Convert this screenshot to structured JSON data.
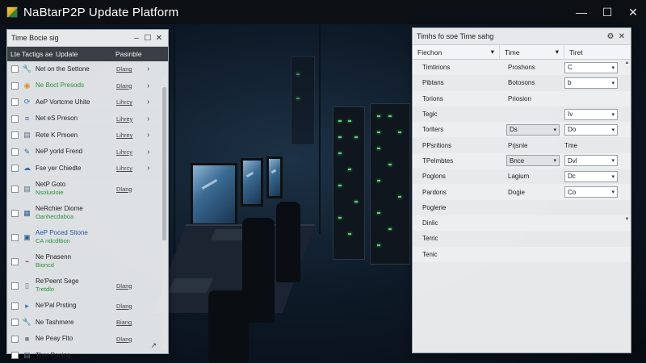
{
  "app": {
    "title": "NaBtarP2P Update Platform",
    "window_controls": {
      "minimize": "—",
      "maximize": "☐",
      "close": "✕"
    }
  },
  "left_panel": {
    "title": "Time Bocie sig",
    "controls": {
      "minimize": "–",
      "maximize": "☐",
      "close": "✕"
    },
    "columns": [
      "Lte Tactigs ae",
      "Update",
      "Pasinble"
    ],
    "rows": [
      {
        "label": "Net on the Settone",
        "status": "Dlang",
        "icon": "wrench-icon",
        "has_arrow": true,
        "style": ""
      },
      {
        "label": "Ne Boct Presods",
        "status": "Dlang",
        "icon": "chrome-icon",
        "has_arrow": true,
        "style": "green"
      },
      {
        "label": "AeP Vortcme Uhite",
        "status": "Lihrcy",
        "icon": "refresh-icon",
        "has_arrow": true,
        "style": ""
      },
      {
        "label": "Net eS Preson",
        "status": "Lihrey",
        "icon": "list-icon",
        "has_arrow": true,
        "style": ""
      },
      {
        "label": "Rete K Pmoen",
        "status": "Lihrey",
        "icon": "document-icon",
        "has_arrow": true,
        "style": ""
      },
      {
        "label": "NeP yorld Frend",
        "status": "Lihrcy",
        "icon": "tool-icon",
        "has_arrow": true,
        "style": ""
      },
      {
        "label": "Fse yer Chiedte",
        "status": "Lihrcy",
        "icon": "cloud-icon",
        "has_arrow": true,
        "style": ""
      },
      {
        "label": "NetP Goto",
        "sub": "Nsolusloie",
        "status": "Dlang",
        "icon": "document-icon",
        "has_arrow": false,
        "style": ""
      },
      {
        "label": "NeRchier Diome",
        "sub": "Oanhecdaboa",
        "status": "",
        "icon": "grid-icon",
        "has_arrow": false,
        "style": ""
      },
      {
        "label": "AeP Poced Sitone",
        "sub": "CA ndcdtbon",
        "status": "",
        "icon": "image-icon",
        "has_arrow": false,
        "style": "blue"
      },
      {
        "label": "Ne Pnasenn",
        "sub": "Bioncd",
        "status": "",
        "icon": "chart-icon",
        "has_arrow": false,
        "style": ""
      },
      {
        "label": "Re'Peent Sege",
        "sub": "Tretdlo",
        "status": "Dlang",
        "icon": "file-icon",
        "has_arrow": false,
        "style": ""
      },
      {
        "label": "Ne'Pal Prsting",
        "status": "Dlang",
        "icon": "play-icon",
        "has_arrow": false,
        "style": ""
      },
      {
        "label": "Ne Tashmere",
        "status": "Biang",
        "icon": "wrench-icon",
        "has_arrow": false,
        "style": ""
      },
      {
        "label": "Ne Peay Flto",
        "status": "Dlang",
        "icon": "box-icon",
        "has_arrow": false,
        "style": ""
      },
      {
        "label": "Ther Pooing",
        "status": "",
        "icon": "document-icon",
        "has_arrow": false,
        "style": ""
      }
    ],
    "footer": "↗"
  },
  "right_panel": {
    "title": "Timhs fo soe Time sahg",
    "controls": {
      "settings": "⚙",
      "close": "✕"
    },
    "columns": [
      "Fiechon",
      "Time",
      "Tiret"
    ],
    "rows": [
      {
        "c1": "Timtirions",
        "c2": "Proshons",
        "c3": "C"
      },
      {
        "c1": "Pibtans",
        "c2": "Botosons",
        "c3": "b"
      },
      {
        "c1": "Torions",
        "c2": "Priosion",
        "c3": ""
      },
      {
        "c1": "Tegic",
        "c2": "",
        "c3": "Iv"
      },
      {
        "c1": "Torlters",
        "c2": "Ds",
        "c3": "Do"
      },
      {
        "c1": "PPsritions",
        "c2": "Prjsnie",
        "c3": "Tme"
      },
      {
        "c1": "TPelmbtes",
        "c2": "Bnce",
        "c3": "Dvl"
      },
      {
        "c1": "Poglons",
        "c2": "Lagium",
        "c3": "Dc"
      },
      {
        "c1": "Pardons",
        "c2": "Dogie",
        "c3": "Co"
      },
      {
        "c1": "Poglerie",
        "c2": "",
        "c3": ""
      },
      {
        "c1": "Dinlic",
        "c2": "",
        "c3": ""
      },
      {
        "c1": "Terric",
        "c2": "",
        "c3": ""
      },
      {
        "c1": "Tenic",
        "c2": "",
        "c3": ""
      }
    ]
  }
}
